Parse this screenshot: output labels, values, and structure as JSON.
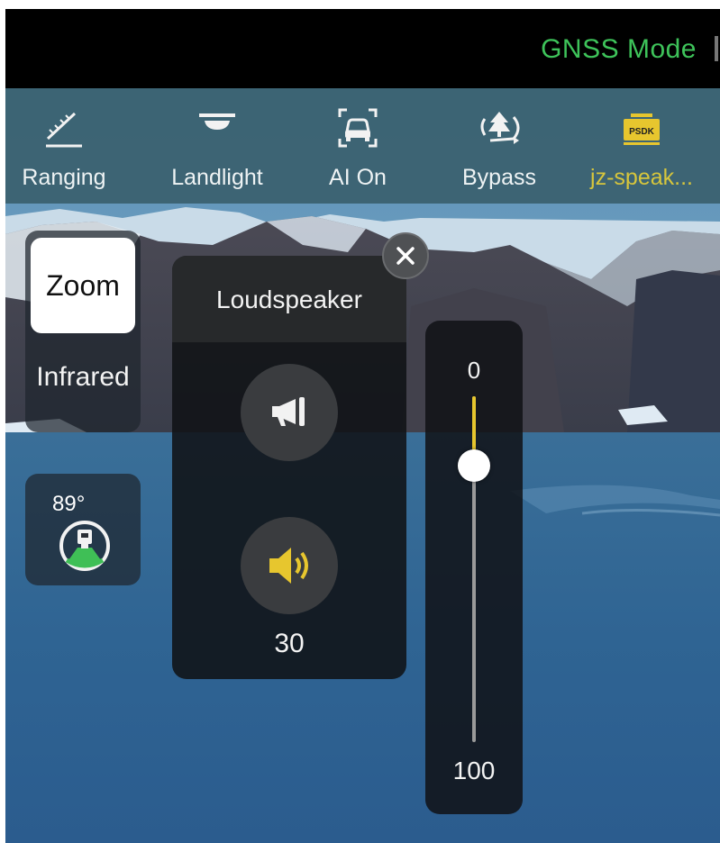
{
  "status_bar": {
    "mode": "GNSS Mode"
  },
  "toolbar": {
    "items": [
      {
        "label": "Ranging",
        "icon": "ruler-icon"
      },
      {
        "label": "Landlight",
        "icon": "landlight-icon"
      },
      {
        "label": "AI On",
        "icon": "ai-car-detect-icon"
      },
      {
        "label": "Bypass",
        "icon": "bypass-tree-icon"
      },
      {
        "label": "jz-speak...",
        "icon": "psdk-icon",
        "badge": "PSDK",
        "active": true
      }
    ]
  },
  "lens": {
    "zoom_label": "Zoom",
    "infrared_label": "Infrared"
  },
  "gimbal": {
    "angle": "89°"
  },
  "speaker_panel": {
    "title": "Loudspeaker",
    "volume": "30"
  },
  "volume_slider": {
    "min_label": "0",
    "max_label": "100",
    "level_fraction": 0.2
  },
  "colors": {
    "accent": "#e7c62e",
    "gnss": "#3ec35a",
    "toolbar_bg": "#3a606e"
  }
}
